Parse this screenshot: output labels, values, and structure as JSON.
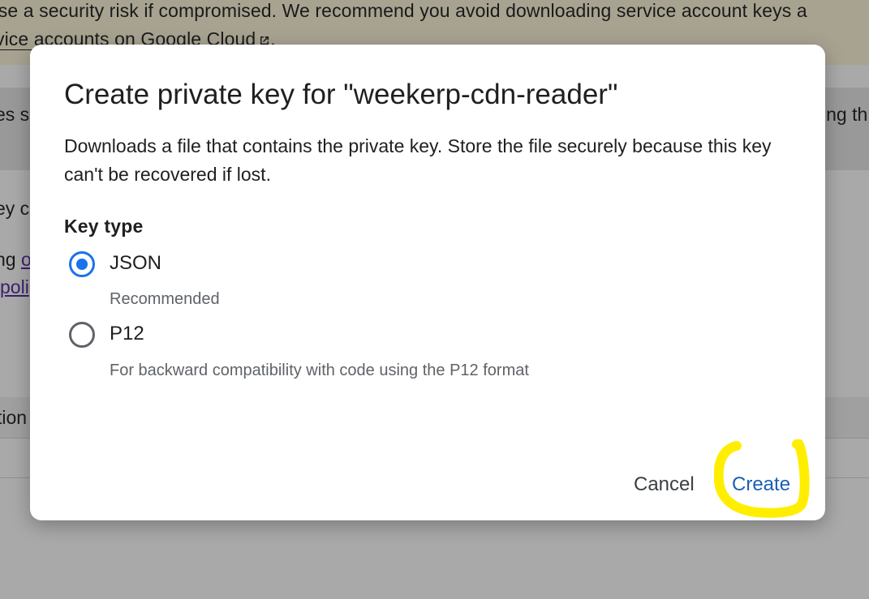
{
  "background": {
    "banner_line_1": "pose a security risk if compromised. We recommend you avoid downloading service account keys a",
    "banner_line_2_prefix": "vice accounts on Google Cloud",
    "banner_line_2_suffix": ".",
    "band_left": "es s",
    "band_right": "ing th",
    "fragment_1": "ey c",
    "fragment_2": "ng ",
    "fragment_2_link": "o",
    "fragment_3_link": "poli",
    "fragment_4": "tion"
  },
  "dialog": {
    "title": "Create private key for \"weekerp-cdn-reader\"",
    "description": "Downloads a file that contains the private key. Store the file securely because this key can't be recovered if lost.",
    "key_type_label": "Key type",
    "options": [
      {
        "label": "JSON",
        "help": "Recommended",
        "selected": true
      },
      {
        "label": "P12",
        "help": "For backward compatibility with code using the P12 format",
        "selected": false
      }
    ],
    "cancel_label": "Cancel",
    "create_label": "Create"
  },
  "colors": {
    "accent": "#1a73e8",
    "highlight": "#ffee00",
    "scrim": "#a9a9a9"
  }
}
